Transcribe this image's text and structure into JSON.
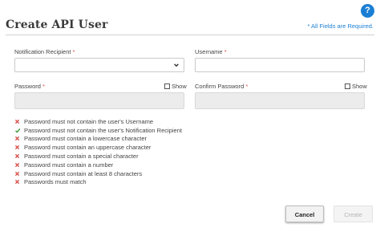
{
  "header": {
    "help_label": "?",
    "title": "Create API User",
    "required_note": "* All Fields are Required."
  },
  "form": {
    "notification_recipient": {
      "label": "Notification Recipient",
      "required_marker": "*",
      "value": ""
    },
    "username": {
      "label": "Username",
      "required_marker": "*",
      "value": ""
    },
    "password": {
      "label": "Password",
      "required_marker": "*",
      "value": "",
      "show_label": "Show"
    },
    "confirm_password": {
      "label": "Confirm Password",
      "required_marker": "*",
      "value": "",
      "show_label": "Show"
    }
  },
  "rules": [
    {
      "text": "Password must not contain the user's Username",
      "status": "fail",
      "icon": "x-icon"
    },
    {
      "text": "Password must not contain the user's Notification Recipient",
      "status": "pass",
      "icon": "check-icon"
    },
    {
      "text": "Password must contain a lowercase character",
      "status": "fail",
      "icon": "x-icon"
    },
    {
      "text": "Password must contain an uppercase character",
      "status": "fail",
      "icon": "x-icon"
    },
    {
      "text": "Password must contain a special character",
      "status": "fail",
      "icon": "x-icon"
    },
    {
      "text": "Password must contain a number",
      "status": "fail",
      "icon": "x-icon"
    },
    {
      "text": "Password must contain at least 8 characters",
      "status": "fail",
      "icon": "x-icon"
    },
    {
      "text": "Passwords must match",
      "status": "fail",
      "icon": "x-icon"
    }
  ],
  "buttons": {
    "cancel_label": "Cancel",
    "create_label": "Create"
  },
  "colors": {
    "accent": "#1a7fd4",
    "fail": "#d9534f",
    "pass": "#3c9a3c",
    "required": "#d9534f"
  }
}
